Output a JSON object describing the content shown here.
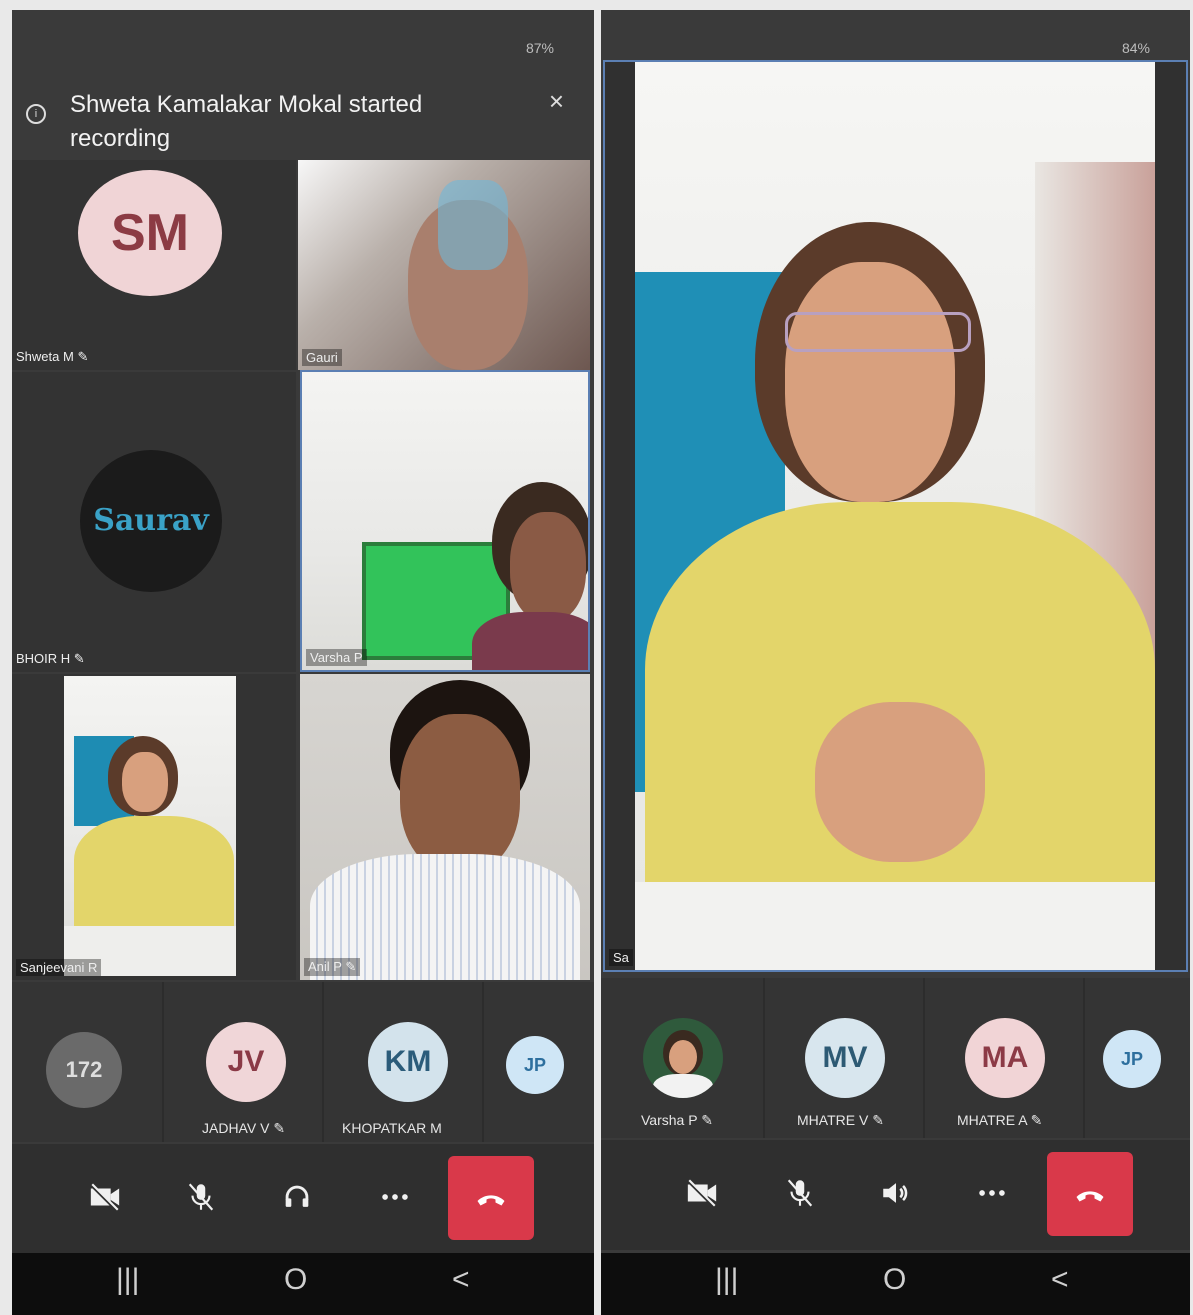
{
  "left": {
    "battery": "87%",
    "banner": {
      "message": "Shweta Kamalakar Mokal started recording",
      "close": "×"
    },
    "tiles": {
      "shweta": {
        "initials": "SM",
        "name": "Shweta M"
      },
      "gauri": {
        "name": "Gauri"
      },
      "bhoir": {
        "logo_text": "Saurav",
        "name": "BHOIR H"
      },
      "varsha": {
        "name": "Varsha P"
      },
      "sanjeevani": {
        "name": "Sanjeevani R"
      },
      "anil": {
        "name": "Anil P"
      }
    },
    "participants": {
      "more": "172",
      "p1": {
        "initials": "JV",
        "name": "JADHAV V"
      },
      "p2": {
        "initials": "KM",
        "name": "KHOPATKAR M"
      },
      "p3": {
        "initials": "JP"
      }
    },
    "colors": {
      "end": "#d9394a"
    }
  },
  "right": {
    "battery": "84%",
    "main_name": "Sa",
    "participants": {
      "p1": {
        "name": "Varsha P"
      },
      "p2": {
        "initials": "MV",
        "name": "MHATRE V"
      },
      "p3": {
        "initials": "MA",
        "name": "MHATRE A"
      },
      "p4": {
        "initials": "JP"
      }
    }
  },
  "icons": {
    "camera": "camera-off-icon",
    "mic": "mic-off-icon",
    "audio_left": "headset-icon",
    "audio_right": "speaker-icon",
    "more": "more-icon",
    "end": "end-call-icon",
    "nav_recent": "|||",
    "nav_home": "O",
    "nav_back": "<"
  }
}
